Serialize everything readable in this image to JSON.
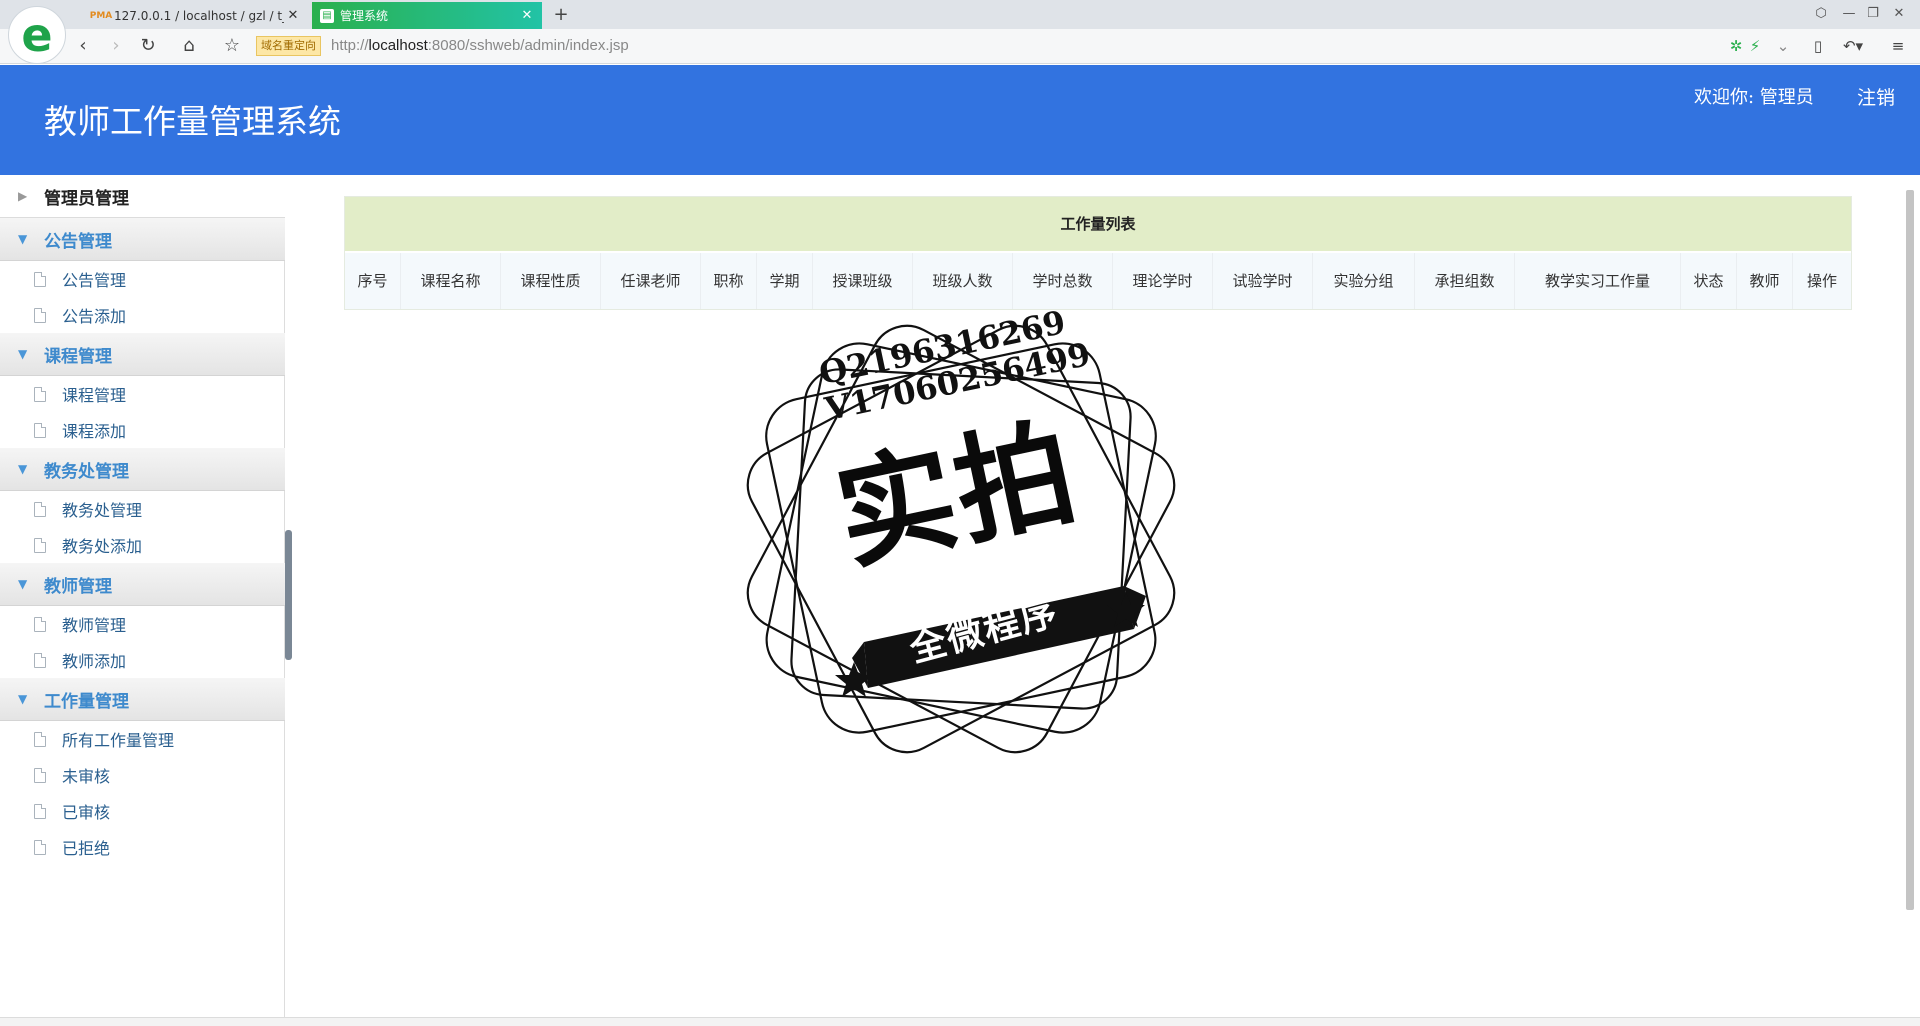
{
  "browser": {
    "tabs": [
      {
        "title": "127.0.0.1 / localhost / gzl / t_",
        "favicon": "PMA",
        "active": false
      },
      {
        "title": "管理系统",
        "favicon": "page-icon",
        "active": true
      }
    ],
    "new_tab": "+",
    "redirect_badge": "域名重定向",
    "url_scheme": "http://",
    "url_host": "localhost",
    "url_rest": ":8080/sshweb/admin/index.jsp",
    "colors": {
      "active_tab": "#2ab04d",
      "logo": "#1fa34a"
    }
  },
  "header": {
    "title": "教师工作量管理系统",
    "welcome": "欢迎你: 管理员",
    "logout": "注销",
    "bg_color": "#3273e0"
  },
  "sidebar": {
    "groups": [
      {
        "label": "管理员管理",
        "expanded": false,
        "items": []
      },
      {
        "label": "公告管理",
        "expanded": true,
        "items": [
          "公告管理",
          "公告添加"
        ]
      },
      {
        "label": "课程管理",
        "expanded": true,
        "items": [
          "课程管理",
          "课程添加"
        ]
      },
      {
        "label": "教务处管理",
        "expanded": true,
        "items": [
          "教务处管理",
          "教务处添加"
        ]
      },
      {
        "label": "教师管理",
        "expanded": true,
        "items": [
          "教师管理",
          "教师添加"
        ]
      },
      {
        "label": "工作量管理",
        "expanded": true,
        "items": [
          "所有工作量管理",
          "未审核",
          "已审核",
          "已拒绝"
        ]
      }
    ]
  },
  "main": {
    "panel_title": "工作量列表",
    "columns": [
      "序号",
      "课程名称",
      "课程性质",
      "任课老师",
      "职称",
      "学期",
      "授课班级",
      "班级人数",
      "学时总数",
      "理论学时",
      "试验学时",
      "实验分组",
      "承担组数",
      "教学实习工作量",
      "状态",
      "教师",
      "操作"
    ],
    "rows": []
  },
  "watermark": {
    "line1": "Q2196316269",
    "line2": "V17060256499",
    "big": "实拍",
    "ribbon": "全微程序"
  }
}
